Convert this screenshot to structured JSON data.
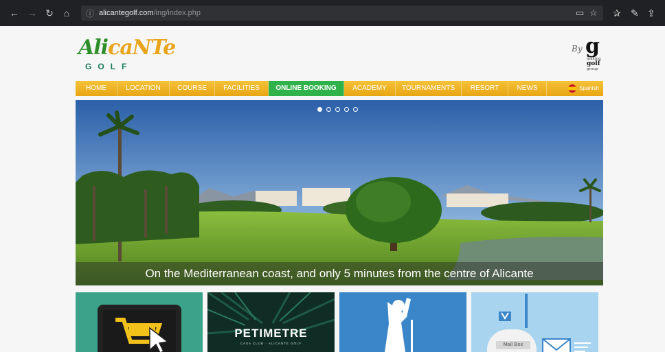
{
  "browser": {
    "url_host": "alicantegolf.com",
    "url_path": "/ing/index.php"
  },
  "logo": {
    "script_a": "Ali",
    "script_b": "caNTe",
    "golf": "GOLF"
  },
  "partner": {
    "by": "By",
    "g": "g",
    "line1": "making",
    "line2": "golf",
    "line3": "group"
  },
  "nav": {
    "items": [
      "HOME",
      "LOCATION",
      "COURSE",
      "FACILITIES",
      "ONLINE BOOKING",
      "ACADEMY",
      "TOURNAMENTS",
      "RESORT",
      "NEWS"
    ],
    "active": "ONLINE BOOKING",
    "language": "Spanish"
  },
  "slider": {
    "caption": "On the Mediterranean coast, and only 5 minutes from the centre of Alicante",
    "dots": 5,
    "active_dot": 1
  },
  "tiles": {
    "petimetre": "PETIMETRE",
    "petimetre_sub": "CASA CLUB · ALICANTE GOLF",
    "mailbox": "Mail Box"
  },
  "colors": {
    "nav_yellow": "#e8a513",
    "nav_active_green": "#2fb24a"
  }
}
